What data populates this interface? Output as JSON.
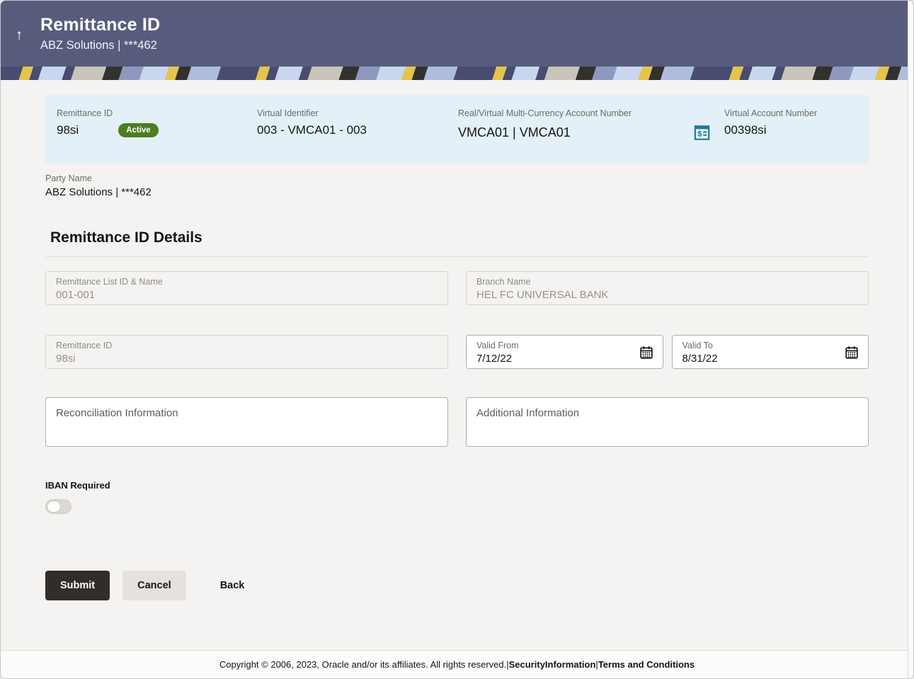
{
  "header": {
    "title": "Remittance ID",
    "subtitle": "ABZ Solutions | ***462",
    "back_icon_glyph": "↑"
  },
  "summary": {
    "fields": [
      {
        "label": "Remittance ID",
        "value": "98si",
        "badge": "Active"
      },
      {
        "label": "Virtual Identifier",
        "value": "003 - VMCA01 - 003"
      },
      {
        "label": "Real/Virtual Multi-Currency Account Number",
        "value": "VMCA01 | VMCA01",
        "icon": "currency-statement-icon"
      },
      {
        "label": "Virtual Account Number",
        "value": "00398si"
      }
    ]
  },
  "party": {
    "label": "Party Name",
    "value": "ABZ Solutions | ***462"
  },
  "section": {
    "title": "Remittance ID Details"
  },
  "form": {
    "remittance_list": {
      "label": "Remittance List ID & Name",
      "value": "001-001",
      "state": "disabled"
    },
    "branch_name": {
      "label": "Branch Name",
      "value": "HEL FC UNIVERSAL BANK",
      "state": "disabled"
    },
    "remittance_id": {
      "label": "Remittance ID",
      "value": "98si",
      "state": "disabled"
    },
    "valid_from": {
      "label": "Valid From",
      "value": "7/12/22",
      "icon": "calendar-icon"
    },
    "valid_to": {
      "label": "Valid To",
      "value": "8/31/22",
      "icon": "calendar-icon"
    },
    "reconciliation_info": {
      "placeholder": "Reconciliation Information",
      "value": ""
    },
    "additional_info": {
      "placeholder": "Additional Information",
      "value": ""
    },
    "iban_required": {
      "label": "IBAN Required",
      "state": "off"
    }
  },
  "actions": {
    "submit": "Submit",
    "cancel": "Cancel",
    "back": "Back"
  },
  "footer": {
    "copyright": "Copyright © 2006, 2023, Oracle and/or its affiliates. All rights reserved.",
    "separator": "|",
    "security_link": "SecurityInformation",
    "terms_link": "Terms and Conditions"
  },
  "colors": {
    "header_background": "#575c7d",
    "summary_background": "#e3f0f7",
    "active_badge": "#4c7d20",
    "account_icon": "#1b7a95",
    "submit_button": "#312d2a",
    "page_background": "#f4f3f1"
  }
}
